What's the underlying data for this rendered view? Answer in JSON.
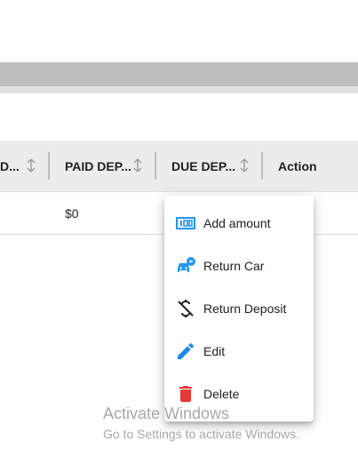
{
  "table": {
    "columns": [
      {
        "label": "D...",
        "sortable": true
      },
      {
        "label": "PAID DEP...",
        "sortable": true
      },
      {
        "label": "DUE DEP...",
        "sortable": true
      },
      {
        "label": "Action",
        "sortable": false
      }
    ],
    "rows": [
      {
        "paid_deposit": "$0"
      }
    ]
  },
  "action_menu": {
    "items": [
      {
        "label": "Add amount",
        "icon": "money-icon",
        "color": "#2196f3"
      },
      {
        "label": "Return Car",
        "icon": "car-return-icon",
        "color": "#2196f3"
      },
      {
        "label": "Return Deposit",
        "icon": "money-off-icon",
        "color": "#212121"
      },
      {
        "label": "Edit",
        "icon": "pencil-icon",
        "color": "#1e88e5"
      },
      {
        "label": "Delete",
        "icon": "trash-icon",
        "color": "#e53935"
      }
    ]
  },
  "watermark": {
    "title": "Activate Windows",
    "subtitle": "Go to Settings to activate Windows."
  }
}
